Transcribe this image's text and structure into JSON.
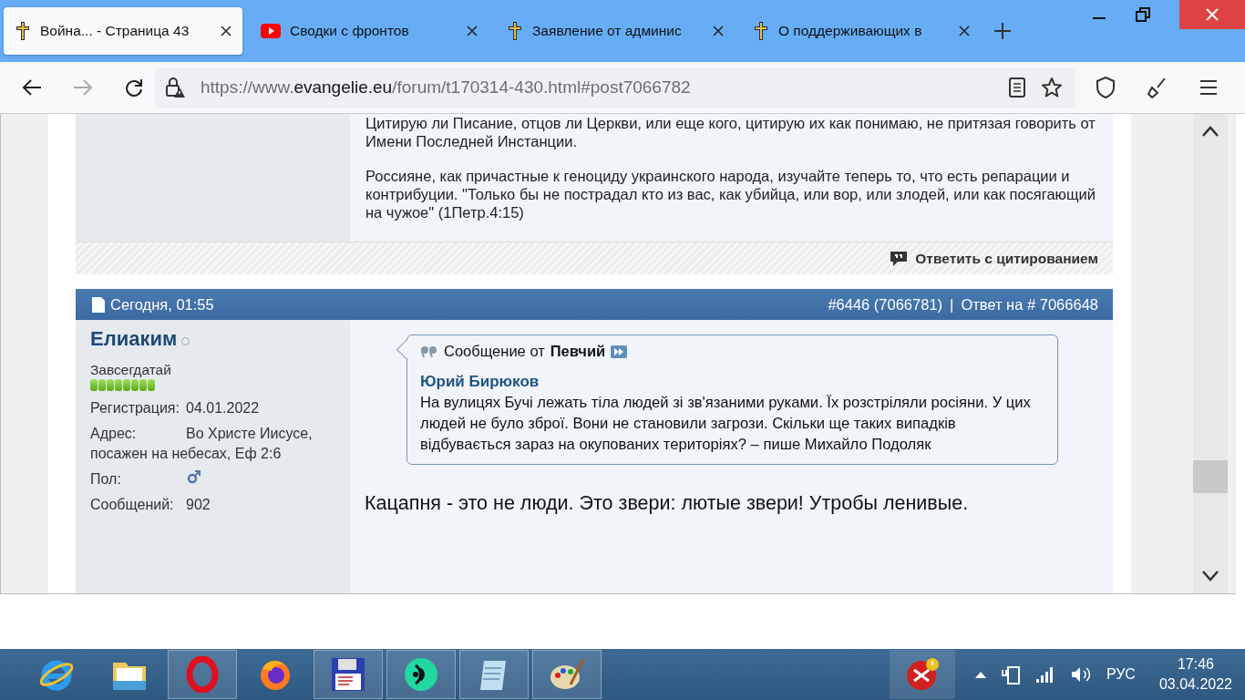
{
  "browser": {
    "tabs": [
      {
        "title": "Война... - Страница 43",
        "selected": true,
        "kind": "site"
      },
      {
        "title": "Сводки с фронтов",
        "selected": false,
        "kind": "video"
      },
      {
        "title": "Заявление от админис",
        "selected": false,
        "kind": "site"
      },
      {
        "title": "О поддерживающих в",
        "selected": false,
        "kind": "site"
      }
    ],
    "url": {
      "prefix": "https://www.",
      "domain": "evangelie.eu",
      "path": "/forum/t170314-430.html#post7066782"
    }
  },
  "previous_post": {
    "paragraphs": [
      "Цитирую ли Писание, отцов ли Церкви, или еще кого, цитирую их как понимаю, не притязая говорить от Имени Последней Инстанции.",
      "Россияне, как причастные к геноциду украинского народа, изучайте теперь то, что есть репарации и контрибуции. \"Только бы не пострадал кто из вас, как убийца, или вор, или злодей, или как посягающий на чужое\" (1Петр.4:15)"
    ],
    "reply_quote_button": "Ответить с цитированием"
  },
  "post": {
    "date": "Сегодня, 01:55",
    "number": "#6446 (7066781)",
    "separator": "|",
    "reply_to": "Ответ на # 7066648",
    "user": {
      "name": "Елиаким",
      "online": false,
      "rank": "Завсегдатай",
      "stars": 8,
      "fields": [
        {
          "label": "Регистрация:",
          "value": "04.01.2022",
          "kind": "text"
        },
        {
          "label": "Адрес:",
          "value": "Во Христе Иисусе, посажен на небесах, Еф 2:6",
          "kind": "text"
        },
        {
          "label": "Пол:",
          "kind": "gender"
        },
        {
          "label": "Сообщений:",
          "value": "902",
          "kind": "text"
        }
      ]
    },
    "quote": {
      "prefix": "Сообщение от",
      "author": "Певчий",
      "title": "Юрий Бирюков",
      "text": "На вулицях Бучі лежать тіла людей зі зв'язаними руками. Їх розстріляли росіяни. У цих людей не було зброї. Вони не становили загрози. Скільки ще таких випадків відбувається зараз на окупованих територіях? – пише Михайло Подоляк"
    },
    "message": "Кацапня - это не люди. Это звери: лютые звери! Утробы ленивые."
  },
  "taskbar": {
    "apps": [
      {
        "kind": "explorer",
        "running": false
      },
      {
        "kind": "folder",
        "running": false
      },
      {
        "kind": "opera",
        "running": true
      },
      {
        "kind": "firefox",
        "running": false
      },
      {
        "kind": "floppy",
        "running": true
      },
      {
        "kind": "green",
        "running": true
      },
      {
        "kind": "notepad",
        "running": true
      },
      {
        "kind": "paint",
        "running": true
      }
    ],
    "language": "РУС",
    "time": "17:46",
    "date": "03.04.2022"
  }
}
